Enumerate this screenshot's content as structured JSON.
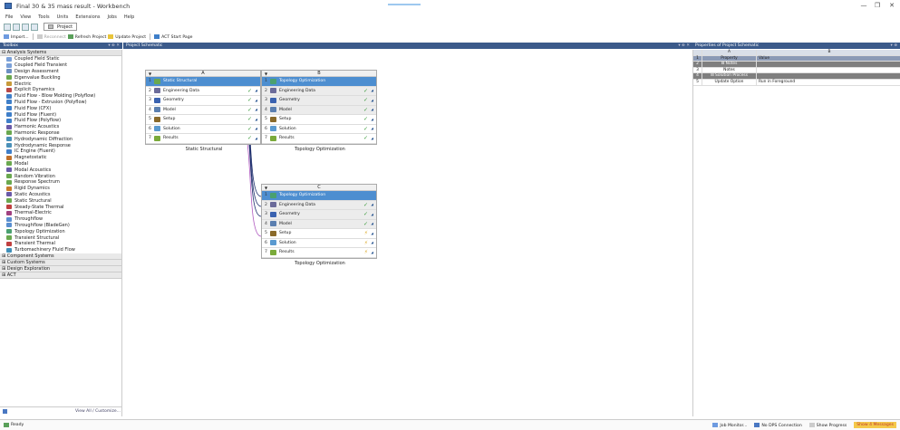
{
  "window": {
    "title": "Final 30 & 35 mass result - Workbench",
    "minimize": "—",
    "restore": "❐",
    "close": "✕"
  },
  "menu": [
    "File",
    "View",
    "Tools",
    "Units",
    "Extensions",
    "Jobs",
    "Help"
  ],
  "toolbar": {
    "project_tab": "Project",
    "import": "Import...",
    "reconnect": "Reconnect",
    "refresh": "Refresh Project",
    "update": "Update Project",
    "act": "ACT Start Page"
  },
  "panels": {
    "toolbox": "Toolbox",
    "toolbox_ctrl": "▾ ⊕ ✕",
    "schematic": "Project Schematic",
    "schematic_ctrl": "▾ ⊕ ✕",
    "properties": "Properties of Project Schematic",
    "properties_ctrl": "▾ ⊕"
  },
  "toolbox": {
    "analysis_header": "⊟ Analysis Systems",
    "items": [
      "Coupled Field Static",
      "Coupled Field Transient",
      "Design Assessment",
      "Eigenvalue Buckling",
      "Electric",
      "Explicit Dynamics",
      "Fluid Flow - Blow Molding (Polyflow)",
      "Fluid Flow - Extrusion (Polyflow)",
      "Fluid Flow (CFX)",
      "Fluid Flow (Fluent)",
      "Fluid Flow (Polyflow)",
      "Harmonic Acoustics",
      "Harmonic Response",
      "Hydrodynamic Diffraction",
      "Hydrodynamic Response",
      "IC Engine (Fluent)",
      "Magnetostatic",
      "Modal",
      "Modal Acoustics",
      "Random Vibration",
      "Response Spectrum",
      "Rigid Dynamics",
      "Static Acoustics",
      "Static Structural",
      "Steady-State Thermal",
      "Thermal-Electric",
      "Throughflow",
      "Throughflow (BladeGen)",
      "Topology Optimization",
      "Transient Structural",
      "Transient Thermal",
      "Turbomachinery Fluid Flow"
    ],
    "icon_colors": [
      "#7aa0d8",
      "#7aa0d8",
      "#6c8fc2",
      "#6aa84f",
      "#c89a3a",
      "#b84848",
      "#3f7fc9",
      "#3f7fc9",
      "#3f7fc9",
      "#3f7fc9",
      "#3f7fc9",
      "#6a5aa8",
      "#6aa84f",
      "#4a90b8",
      "#4a90b8",
      "#3f7fc9",
      "#c0702a",
      "#6aa84f",
      "#6a5aa8",
      "#6aa84f",
      "#6aa84f",
      "#c87a2a",
      "#6a5aa8",
      "#6aa84f",
      "#c04040",
      "#a04080",
      "#5a8fd0",
      "#5a8fd0",
      "#4aa070",
      "#6aa84f",
      "#c04040",
      "#3f8fb9"
    ],
    "sections": [
      "⊞ Component Systems",
      "⊞ Custom Systems",
      "⊞ Design Exploration",
      "⊞ ACT"
    ],
    "filter_icon": "filter-icon",
    "view_all": "View All / Customize..."
  },
  "systems": [
    {
      "letter": "A",
      "caption": "Static Structural",
      "cells": [
        {
          "n": "1",
          "label": "Static Structural",
          "status": "",
          "kind": "blue",
          "icon": "#6aa84f"
        },
        {
          "n": "2",
          "label": "Engineering Data",
          "status": "✓",
          "kind": "",
          "icon": "#6b6b9a"
        },
        {
          "n": "3",
          "label": "Geometry",
          "status": "✓",
          "kind": "",
          "icon": "#3a62b0"
        },
        {
          "n": "4",
          "label": "Model",
          "status": "✓",
          "kind": "",
          "icon": "#5b7fb0"
        },
        {
          "n": "5",
          "label": "Setup",
          "status": "✓",
          "kind": "",
          "icon": "#8a6a2a"
        },
        {
          "n": "6",
          "label": "Solution",
          "status": "✓",
          "kind": "",
          "icon": "#5a9ad0"
        },
        {
          "n": "7",
          "label": "Results",
          "status": "✓",
          "kind": "",
          "icon": "#7aaa3a"
        }
      ]
    },
    {
      "letter": "B",
      "caption": "Topology Optimization",
      "cells": [
        {
          "n": "1",
          "label": "Topology Optimization",
          "status": "",
          "kind": "blue",
          "icon": "#4aa070"
        },
        {
          "n": "2",
          "label": "Engineering Data",
          "status": "✓",
          "kind": "grey",
          "icon": "#6b6b9a"
        },
        {
          "n": "3",
          "label": "Geometry",
          "status": "✓",
          "kind": "grey",
          "icon": "#3a62b0"
        },
        {
          "n": "4",
          "label": "Model",
          "status": "✓",
          "kind": "grey",
          "icon": "#5b7fb0"
        },
        {
          "n": "5",
          "label": "Setup",
          "status": "✓",
          "kind": "",
          "icon": "#8a6a2a"
        },
        {
          "n": "6",
          "label": "Solution",
          "status": "✓",
          "kind": "",
          "icon": "#5a9ad0"
        },
        {
          "n": "7",
          "label": "Results",
          "status": "✓",
          "kind": "",
          "icon": "#7aaa3a"
        }
      ]
    },
    {
      "letter": "C",
      "caption": "Topology Optimization",
      "cells": [
        {
          "n": "1",
          "label": "Topology Optimization",
          "status": "",
          "kind": "blue",
          "icon": "#4aa070"
        },
        {
          "n": "2",
          "label": "Engineering Data",
          "status": "✓",
          "kind": "grey",
          "icon": "#6b6b9a"
        },
        {
          "n": "3",
          "label": "Geometry",
          "status": "✓",
          "kind": "grey",
          "icon": "#3a62b0"
        },
        {
          "n": "4",
          "label": "Model",
          "status": "✓",
          "kind": "grey",
          "icon": "#5b7fb0"
        },
        {
          "n": "5",
          "label": "Setup",
          "status": "⚡",
          "kind": "",
          "icon": "#8a6a2a"
        },
        {
          "n": "6",
          "label": "Solution",
          "status": "⚡",
          "kind": "",
          "icon": "#5a9ad0"
        },
        {
          "n": "7",
          "label": "Results",
          "status": "⚡",
          "kind": "",
          "icon": "#7aaa3a"
        }
      ]
    }
  ],
  "properties": {
    "col_a": "A",
    "col_b": "B",
    "rows": [
      {
        "n": "1",
        "prop": "Property",
        "val": "Value",
        "kind": "h"
      },
      {
        "n": "2",
        "prop": "⊟ Notes",
        "val": "",
        "kind": "sec"
      },
      {
        "n": "3",
        "prop": "Notes",
        "val": "",
        "kind": ""
      },
      {
        "n": "4",
        "prop": "⊟ Solution Process",
        "val": "",
        "kind": "sec"
      },
      {
        "n": "5",
        "prop": "Update Option",
        "val": "Run in Foreground",
        "kind": ""
      }
    ]
  },
  "status": {
    "ready": "Ready",
    "job_monitor": "Job Monitor...",
    "dps": "No DPS Connection",
    "progress": "Show Progress",
    "messages": "Show 4 Messages"
  }
}
